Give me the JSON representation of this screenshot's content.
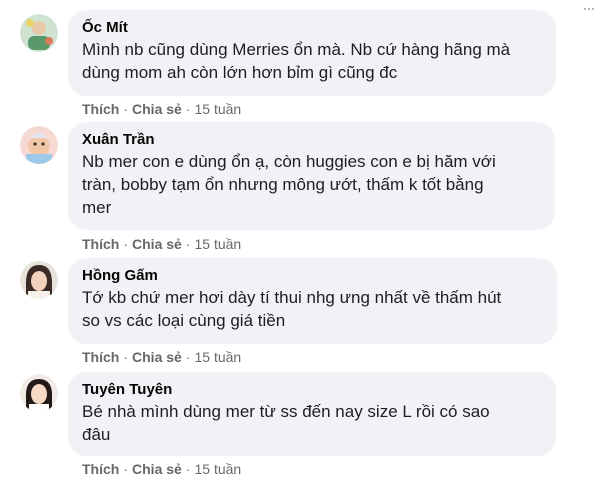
{
  "comments": [
    {
      "author": "Ốc Mít",
      "text": "Mình nb cũng dùng Merries ổn mà. Nb cứ hàng hãng mà\ndùng mom ah còn lớn hơn bỉm gì cũng đc",
      "like_label": "Thích",
      "share_label": "Chia sẻ",
      "separator": "·",
      "time": "15 tuần",
      "avatar_icon": "avatar-photo"
    },
    {
      "author": "Xuân Trần",
      "text": "Nb mer con e dùng ổn ạ, còn huggies con e bị hăm với\ntràn, bobby tạm ổn nhưng mông ướt, thấm k tốt bằng\nmer",
      "like_label": "Thích",
      "share_label": "Chia sẻ",
      "separator": "·",
      "time": "15 tuần",
      "avatar_icon": "avatar-photo"
    },
    {
      "author": "Hồng Gấm",
      "text": "Tớ kb chứ mer hơi dày tí thui nhg ưng nhất về thấm hút\nso vs các loại cùng giá tiền",
      "like_label": "Thích",
      "share_label": "Chia sẻ",
      "separator": "·",
      "time": "15 tuần",
      "avatar_icon": "avatar-photo"
    },
    {
      "author": "Tuyên Tuyên",
      "text": "Bé nhà mình dùng mer từ ss đến nay size L rồi có sao\nđâu",
      "like_label": "Thích",
      "share_label": "Chia sẻ",
      "separator": "·",
      "time": "15 tuần",
      "avatar_icon": "avatar-photo"
    }
  ],
  "colors": {
    "bubble_bg": "#f0f2f5",
    "meta_text": "#65676b",
    "body_text": "#1c1e21"
  }
}
